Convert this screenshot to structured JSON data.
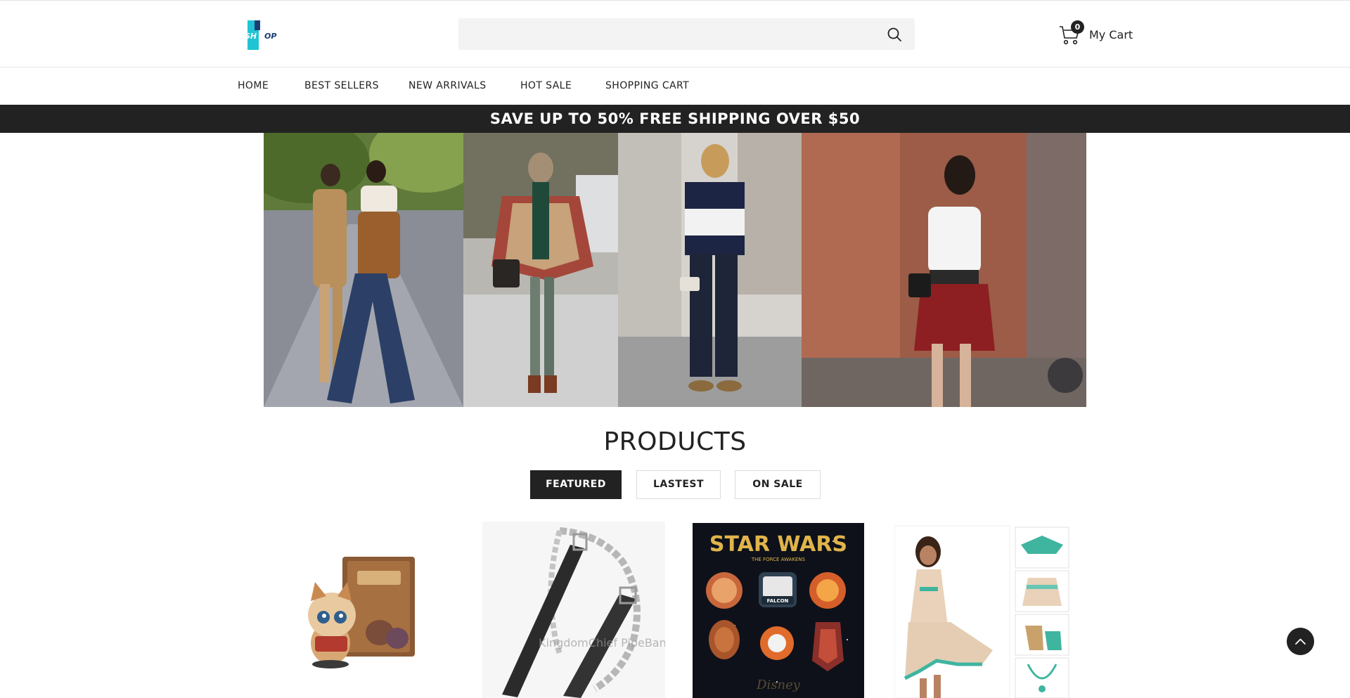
{
  "header": {
    "logo_text": "SHOP",
    "search": {
      "value": "",
      "placeholder": ""
    },
    "cart": {
      "count": "0",
      "label": "My Cart"
    }
  },
  "nav": {
    "items": [
      {
        "label": "HOME"
      },
      {
        "label": "BEST SELLERS"
      },
      {
        "label": "NEW ARRIVALS"
      },
      {
        "label": "HOT SALE"
      },
      {
        "label": "SHOPPING CART"
      }
    ]
  },
  "promo": {
    "text": "SAVE UP TO 50% FREE SHIPPING OVER $50"
  },
  "products": {
    "title": "PRODUCTS",
    "tabs": [
      {
        "label": "FEATURED",
        "active": true
      },
      {
        "label": "LASTEST",
        "active": false
      },
      {
        "label": "ON SALE",
        "active": false
      }
    ],
    "items": [
      {
        "kind": "collectible-figure-with-book"
      },
      {
        "kind": "leather-belt-with-chain",
        "watermark": "KingdomChief PipeBandSupplies"
      },
      {
        "kind": "pin-set",
        "poster_title": "STAR WARS",
        "poster_subtitle": "THE FORCE AWAKENS",
        "pin_label": "FALCON"
      },
      {
        "kind": "costume-dress-set"
      }
    ]
  },
  "colors": {
    "dark": "#222222",
    "logo_teal": "#21c4d3",
    "logo_navy": "#1a3e73",
    "search_bg": "#f3f3f3"
  }
}
